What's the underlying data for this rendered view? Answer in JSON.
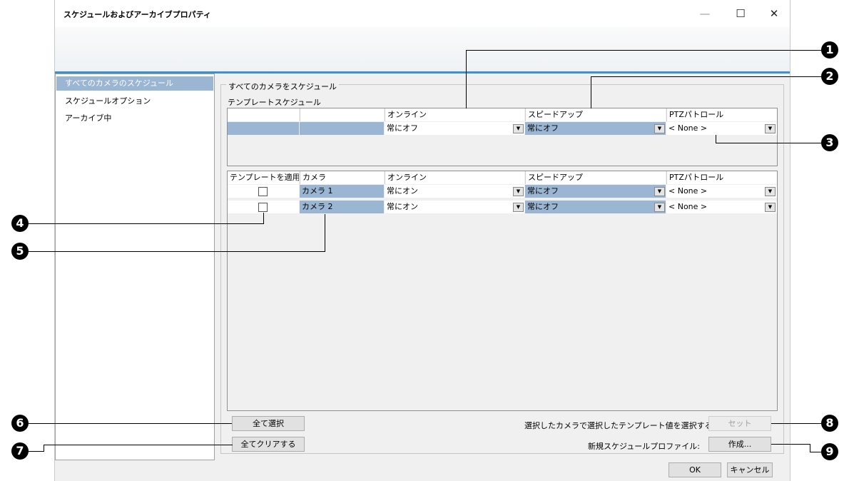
{
  "window": {
    "title": "スケジュールおよびアーカイブプロパティ",
    "minimize": "—",
    "maximize": "☐",
    "close": "✕"
  },
  "nav": {
    "items": [
      {
        "label": "すべてのカメラのスケジュール",
        "selected": true
      },
      {
        "label": "スケジュールオプション",
        "selected": false
      },
      {
        "label": "アーカイブ中",
        "selected": false
      }
    ]
  },
  "group_label": "すべてのカメラをスケジュール",
  "template_label": "テンプレートスケジュール",
  "template_table": {
    "headers": [
      "",
      "",
      "オンライン",
      "スピードアップ",
      "PTZパトロール"
    ],
    "row": [
      "",
      "",
      "常にオフ",
      "常にオフ",
      "< None >"
    ]
  },
  "camera_table": {
    "headers": [
      "テンプレートを適用",
      "カメラ",
      "オンライン",
      "スピードアップ",
      "PTZパトロール"
    ],
    "rows": [
      {
        "checked": false,
        "camera": "カメラ 1",
        "online": "常にオン",
        "speedup": "常にオフ",
        "ptz": "< None >"
      },
      {
        "checked": false,
        "camera": "カメラ 2",
        "online": "常にオン",
        "speedup": "常にオフ",
        "ptz": "< None >"
      }
    ]
  },
  "buttons": {
    "select_all": "全て選択",
    "clear_all": "全てクリアする",
    "set": "セット",
    "create": "作成...",
    "ok": "OK",
    "cancel": "キャンセル"
  },
  "labels": {
    "apply_template": "選択したカメラで選択したテンプレート値を選択する:",
    "new_profile": "新規スケジュールプロファイル:"
  },
  "callouts": [
    "1",
    "2",
    "3",
    "4",
    "5",
    "6",
    "7",
    "8",
    "9"
  ]
}
